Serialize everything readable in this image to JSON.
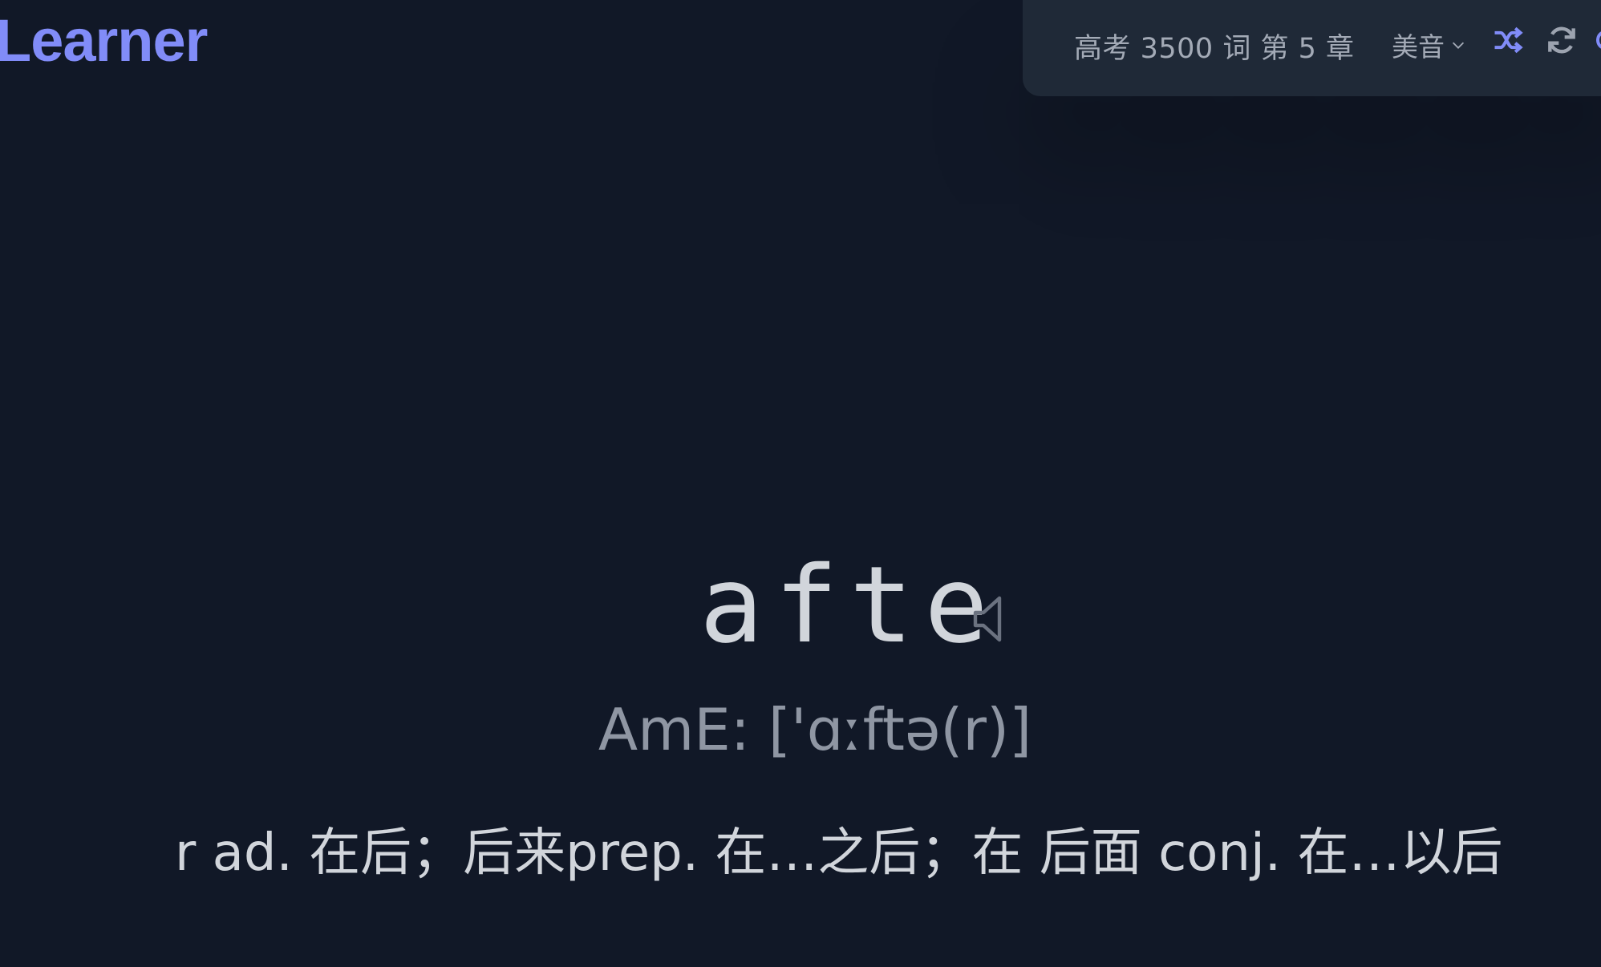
{
  "app": {
    "brand": "Learner"
  },
  "toolbar": {
    "dictionary_label": "高考 3500 词 第 5 章",
    "accent_label": "美音"
  },
  "word": {
    "text": "afte",
    "phonetic": "AmE: ['ɑːftə(r)]",
    "translation": "r ad. 在后；后来prep. 在…之后；在 后面 conj. 在…以后"
  },
  "icons": {
    "accent_chevron": "chevron-down-icon",
    "shuffle": "shuffle-icon",
    "refresh": "refresh-icon",
    "speaker": "speaker-icon"
  },
  "colors": {
    "background": "#111827",
    "toolbar_bg": "#1f2937",
    "accent": "#818cf8",
    "text": "#d1d5db",
    "muted": "#a3aab6"
  }
}
